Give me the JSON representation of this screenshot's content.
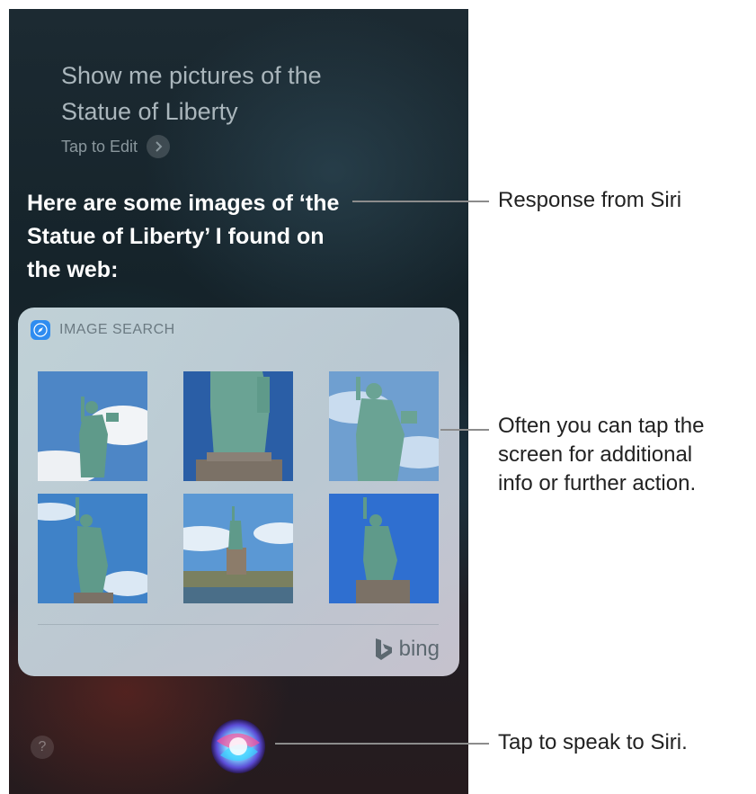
{
  "siri": {
    "query": "Show me pictures of the Statue of Liberty",
    "tap_to_edit": "Tap to Edit",
    "response": "Here are some images of ‘the Statue of Liberty’ I found on the web:",
    "help_glyph": "?"
  },
  "card": {
    "title": "IMAGE SEARCH",
    "icon": "safari-compass-icon",
    "images_alt": [
      "Statue of Liberty photo 1",
      "Statue of Liberty photo 2",
      "Statue of Liberty photo 3",
      "Statue of Liberty photo 4",
      "Statue of Liberty photo 5",
      "Statue of Liberty photo 6"
    ],
    "provider": "bing"
  },
  "callouts": {
    "response": "Response from Siri",
    "tap_screen_1": "Often you can tap the",
    "tap_screen_2": "screen for additional",
    "tap_screen_3": "info or further action.",
    "speak": "Tap to speak to Siri."
  },
  "colors": {
    "statue": "#5f9a8a",
    "sky": "#4d86c6",
    "pedestal": "#7b7166",
    "siri_orb": [
      "#ff4f9a",
      "#3ad3ff",
      "#6b5cff",
      "#ffffff"
    ]
  }
}
